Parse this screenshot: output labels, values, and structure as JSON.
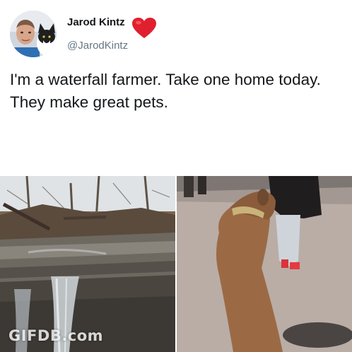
{
  "author": {
    "name": "Jarod Kintz",
    "handle": "@JarodKintz"
  },
  "icons": {
    "avatar": "profile-photo",
    "badge": "red-heart-emoji"
  },
  "tweet": {
    "text": "I'm a waterfall farmer. Take one home today. They make great pets."
  },
  "media": {
    "left": "waterfall-photo",
    "right": "dog-photo"
  },
  "watermark": {
    "text": "GIFDB.com"
  },
  "colors": {
    "name": "#14171a",
    "handle": "#657786",
    "heart": "#e0202e"
  }
}
